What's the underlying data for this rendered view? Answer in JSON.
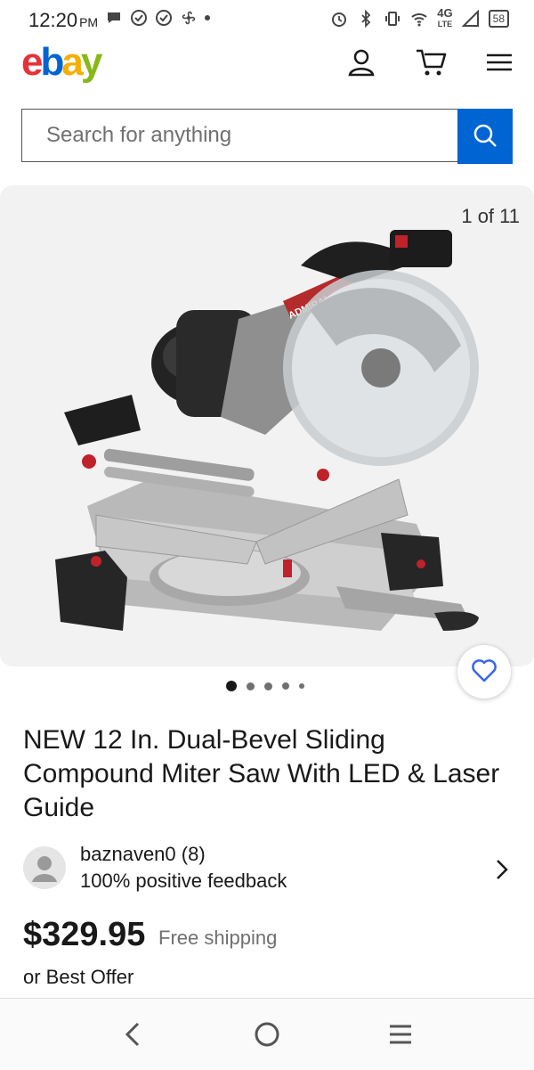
{
  "status_bar": {
    "time": "12:20",
    "ampm": "PM",
    "network": "4G",
    "network_sub": "LTE",
    "battery": "58"
  },
  "header": {
    "logo": {
      "e": "e",
      "b": "b",
      "a": "a",
      "y": "y"
    },
    "icons": [
      "user-icon",
      "cart-icon",
      "menu-icon"
    ]
  },
  "search": {
    "placeholder": "Search for anything",
    "button_icon": "search-icon"
  },
  "gallery": {
    "counter": "1 of 11",
    "brand_on_product": "ADMIRAL",
    "current_slide": 1
  },
  "product": {
    "title": "NEW 12 In. Dual-Bevel Sliding Compound Miter Saw With LED & Laser Guide",
    "price": "$329.95",
    "shipping": "Free shipping",
    "offer": "or Best Offer"
  },
  "seller": {
    "name": "baznaven0 (8)",
    "feedback": "100% positive feedback"
  },
  "colors": {
    "ebay_red": "#e53238",
    "ebay_blue": "#0064d2",
    "ebay_yellow": "#f5af02",
    "ebay_green": "#86b817",
    "watch_heart": "#3665f3"
  }
}
